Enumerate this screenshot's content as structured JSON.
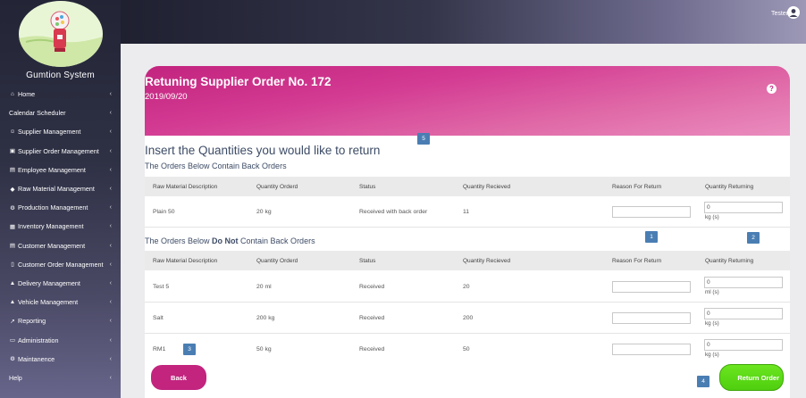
{
  "app": {
    "brand": "Gumtion System",
    "user": "Tester"
  },
  "sidebar": {
    "items": [
      {
        "label": "Home",
        "icon": "home-icon",
        "glyph": "⌂"
      },
      {
        "label": "Calendar Scheduler",
        "icon": "",
        "glyph": ""
      },
      {
        "label": "Supplier Management",
        "icon": "users-icon",
        "glyph": "☺"
      },
      {
        "label": "Supplier Order Management",
        "icon": "truck-icon",
        "glyph": "▣"
      },
      {
        "label": "Employee Management",
        "icon": "id-card-icon",
        "glyph": "▤"
      },
      {
        "label": "Raw Material Management",
        "icon": "tag-icon",
        "glyph": "◆"
      },
      {
        "label": "Production Management",
        "icon": "cogs-icon",
        "glyph": "⚙"
      },
      {
        "label": "Inventory Management",
        "icon": "table-icon",
        "glyph": "▦"
      },
      {
        "label": "Customer Management",
        "icon": "id-card-icon",
        "glyph": "▤"
      },
      {
        "label": "Customer Order Management",
        "icon": "file-icon",
        "glyph": "▯"
      },
      {
        "label": "Delivery Management",
        "icon": "car-icon",
        "glyph": "▲"
      },
      {
        "label": "Vehicle Management",
        "icon": "car-icon",
        "glyph": "▲"
      },
      {
        "label": "Reporting",
        "icon": "chart-line-icon",
        "glyph": "↗"
      },
      {
        "label": "Administration",
        "icon": "laptop-icon",
        "glyph": "▭"
      },
      {
        "label": "Maintanence",
        "icon": "gear-icon",
        "glyph": "⚙"
      },
      {
        "label": "Help",
        "icon": "",
        "glyph": ""
      }
    ],
    "chevron": "‹"
  },
  "banner": {
    "title": "Retuning Supplier Order No. 172",
    "date": "2019/09/20",
    "help_glyph": "?"
  },
  "content": {
    "heading": "Insert the Quantities you would like to return",
    "back_orders_heading": "The Orders Below Contain Back Orders",
    "no_back_orders_prefix": "The Orders Below ",
    "no_back_orders_bold": "Do Not",
    "no_back_orders_suffix": " Contain Back Orders",
    "columns": [
      "Raw Material Description",
      "Quantity Orderd",
      "Status",
      "Quantity Recieved",
      "Reason For Return",
      "Quantity Returning"
    ],
    "back_orders": [
      {
        "description": "Plain 50",
        "quantity": "20 kg",
        "status": "Received with back order",
        "received": "11",
        "returning": "0",
        "unit": "kg (s)"
      }
    ],
    "no_back_orders": [
      {
        "description": "Test 5",
        "quantity": "20 ml",
        "status": "Received",
        "received": "20",
        "returning": "0",
        "unit": "ml (s)"
      },
      {
        "description": "Salt",
        "quantity": "200 kg",
        "status": "Received",
        "received": "200",
        "returning": "0",
        "unit": "kg (s)"
      },
      {
        "description": "RM1",
        "quantity": "50 kg",
        "status": "Received",
        "received": "50",
        "returning": "0",
        "unit": "kg (s)"
      }
    ]
  },
  "badges": {
    "b1": "1",
    "b2": "2",
    "b3": "3",
    "b4": "4",
    "b5": "5"
  },
  "buttons": {
    "back": "Back",
    "return_order": "Return Order"
  },
  "colors": {
    "accent": "#c2247e",
    "primary_green": "#4fcf0f",
    "badge": "#4a7eb3"
  }
}
